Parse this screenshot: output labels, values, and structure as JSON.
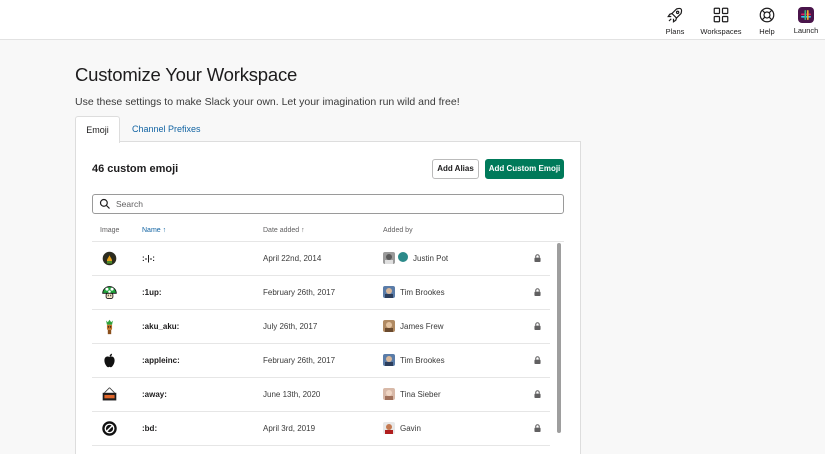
{
  "topnav": {
    "plans": "Plans",
    "workspaces": "Workspaces",
    "help": "Help",
    "launch": "Launch"
  },
  "page": {
    "title": "Customize Your Workspace",
    "subtitle": "Use these settings to make Slack your own. Let your imagination run wild and free!"
  },
  "tabs": [
    "Emoji",
    "Channel Prefixes"
  ],
  "panel": {
    "title": "46 custom emoji",
    "add_alias": "Add Alias",
    "add_custom": "Add Custom Emoji",
    "search_placeholder": "Search",
    "search_value": ""
  },
  "columns": {
    "image": "Image",
    "name": "Name ↑",
    "date": "Date added ↑",
    "added_by": "Added by"
  },
  "rows": [
    {
      "image": "fire-cup-emoji",
      "name": ":-|-:",
      "date": "April 22nd, 2014",
      "added_by": "Justin Pot"
    },
    {
      "image": "mushroom-1up-emoji",
      "name": ":1up:",
      "date": "February 26th, 2017",
      "added_by": "Tim Brookes"
    },
    {
      "image": "tiki-figure-emoji",
      "name": ":aku_aku:",
      "date": "July 26th, 2017",
      "added_by": "James Frew"
    },
    {
      "image": "apple-logo-emoji",
      "name": ":appleinc:",
      "date": "February 26th, 2017",
      "added_by": "Tim Brookes"
    },
    {
      "image": "away-sign-emoji",
      "name": ":away:",
      "date": "June 13th, 2020",
      "added_by": "Tina Sieber"
    },
    {
      "image": "bd-logo-emoji",
      "name": ":bd:",
      "date": "April 3rd, 2019",
      "added_by": "Gavin"
    }
  ],
  "colors": {
    "primary_button": "#007a5a",
    "link": "#1264a3",
    "launch_tile": "#4a154b"
  }
}
